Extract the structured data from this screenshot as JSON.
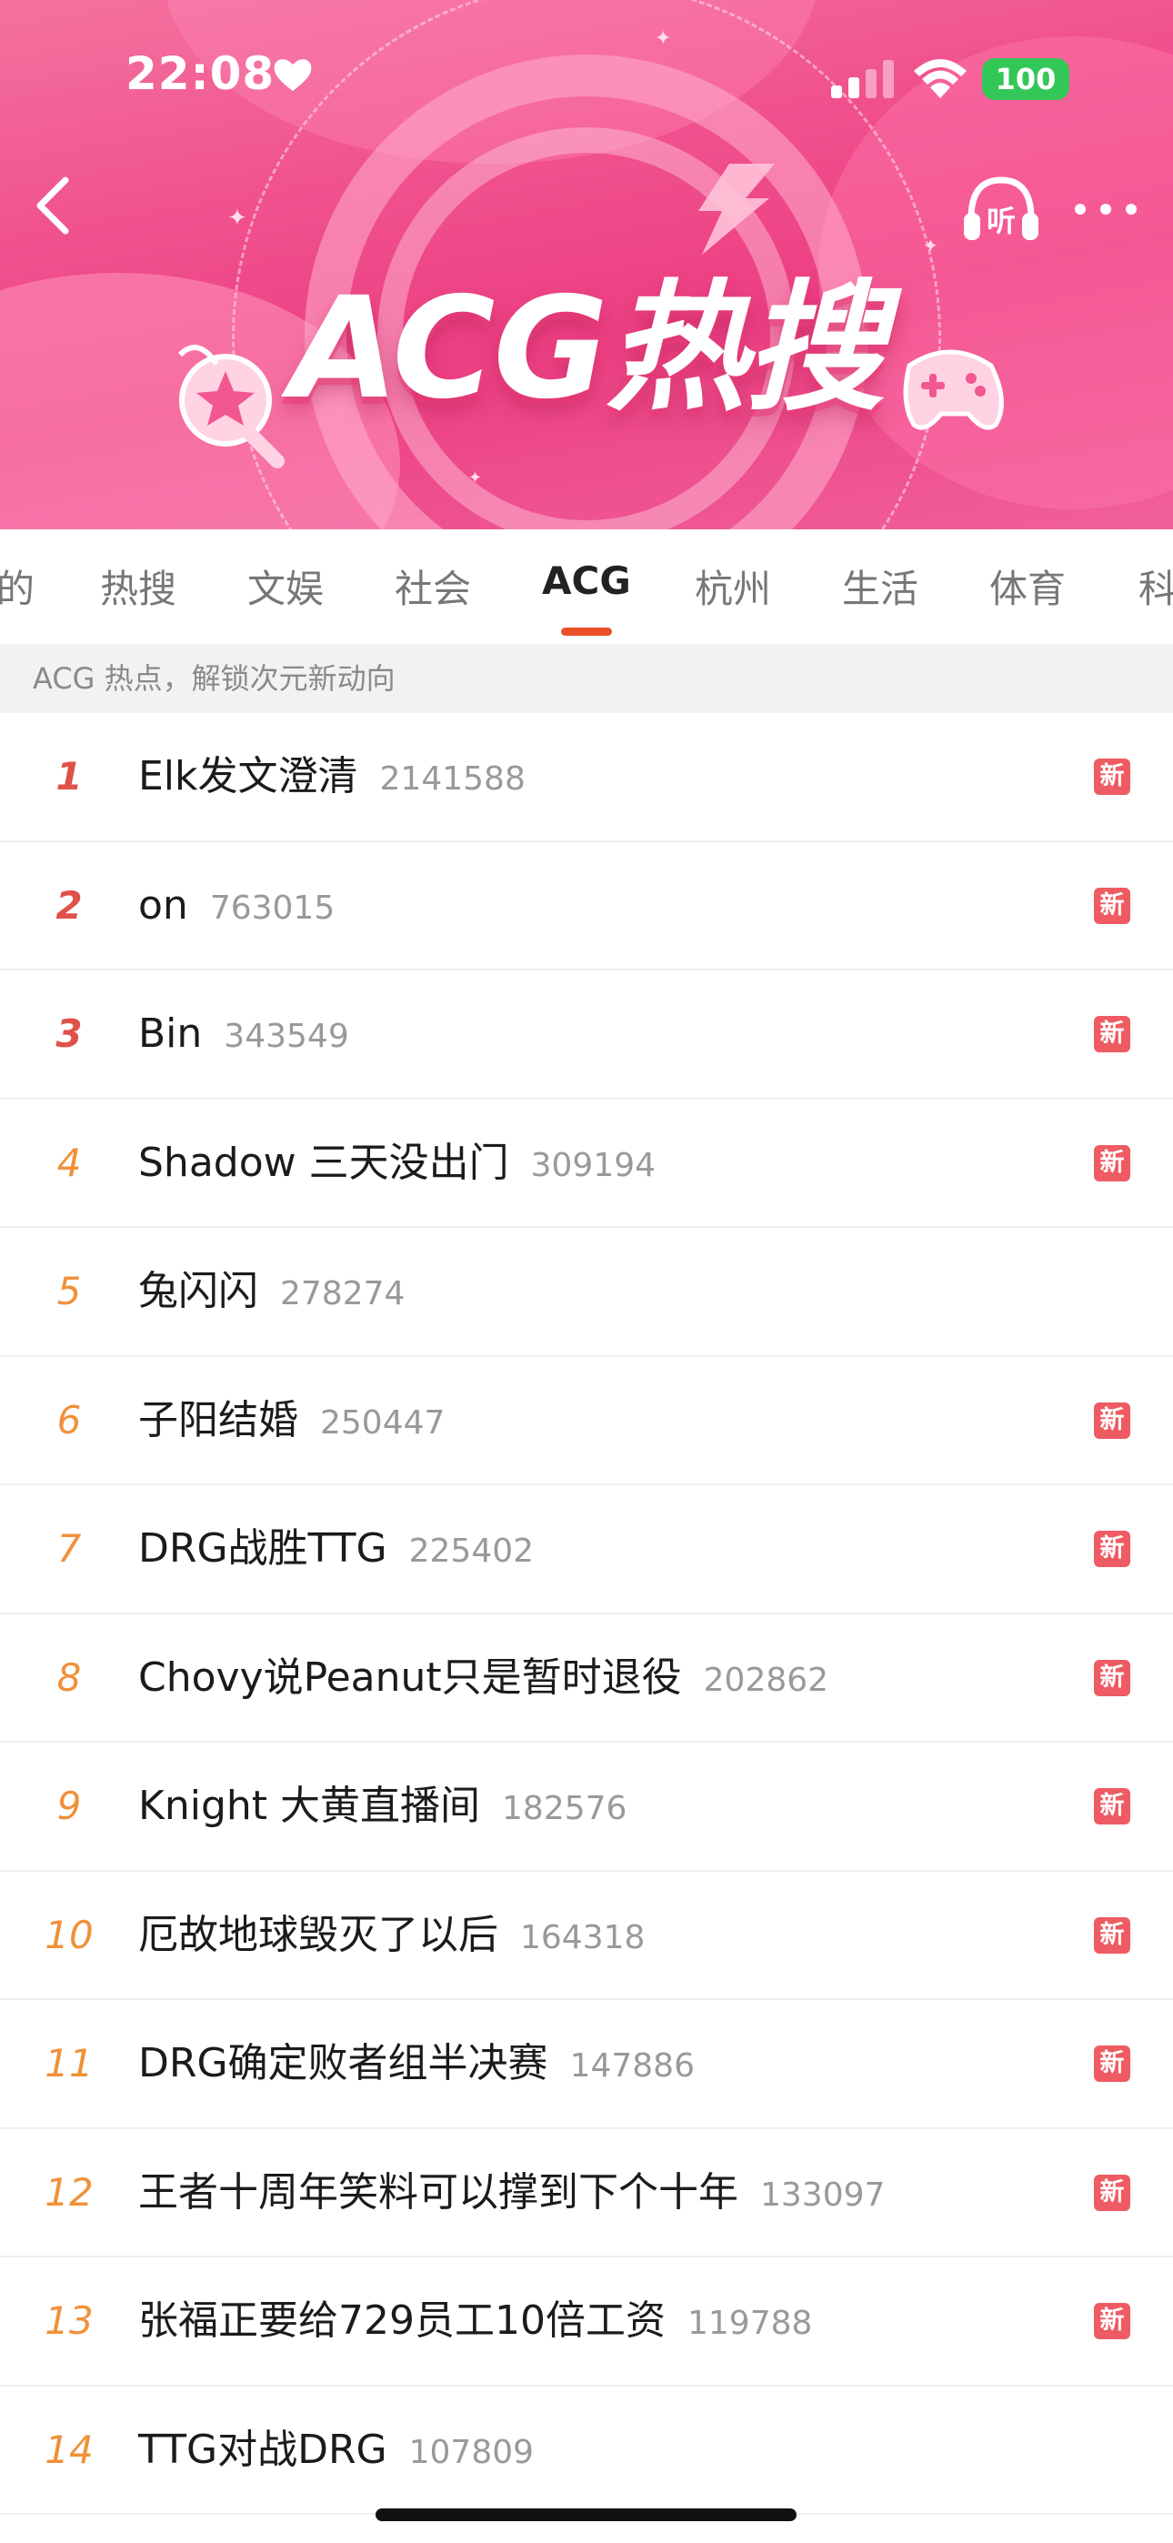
{
  "status_bar": {
    "time": "22:08",
    "battery": "100"
  },
  "header": {
    "title": "ACG热搜",
    "listen_label": "听"
  },
  "tabs": [
    {
      "label": "的"
    },
    {
      "label": "热搜"
    },
    {
      "label": "文娱"
    },
    {
      "label": "社会"
    },
    {
      "label": "ACG",
      "active": true
    },
    {
      "label": "杭州"
    },
    {
      "label": "生活"
    },
    {
      "label": "体育"
    },
    {
      "label": "科"
    }
  ],
  "subheader": "ACG 热点，解锁次元新动向",
  "badge_label": "新",
  "items": [
    {
      "rank": "1",
      "title": "Elk发文澄清",
      "count": "2141588",
      "new": true
    },
    {
      "rank": "2",
      "title": "on",
      "count": "763015",
      "new": true
    },
    {
      "rank": "3",
      "title": "Bin",
      "count": "343549",
      "new": true
    },
    {
      "rank": "4",
      "title": "Shadow 三天没出门",
      "count": "309194",
      "new": true
    },
    {
      "rank": "5",
      "title": "兔闪闪",
      "count": "278274",
      "new": false
    },
    {
      "rank": "6",
      "title": "子阳结婚",
      "count": "250447",
      "new": true
    },
    {
      "rank": "7",
      "title": "DRG战胜TTG",
      "count": "225402",
      "new": true
    },
    {
      "rank": "8",
      "title": "Chovy说Peanut只是暂时退役",
      "count": "202862",
      "new": true
    },
    {
      "rank": "9",
      "title": "Knight 大黄直播间",
      "count": "182576",
      "new": true
    },
    {
      "rank": "10",
      "title": "厄故地球毁灭了以后",
      "count": "164318",
      "new": true
    },
    {
      "rank": "11",
      "title": "DRG确定败者组半决赛",
      "count": "147886",
      "new": true
    },
    {
      "rank": "12",
      "title": "王者十周年笑料可以撑到下个十年",
      "count": "133097",
      "new": true
    },
    {
      "rank": "13",
      "title": "张福正要给729员工10倍工资",
      "count": "119788",
      "new": true
    },
    {
      "rank": "14",
      "title": "TTG对战DRG",
      "count": "107809",
      "new": false
    }
  ],
  "colors": {
    "accent": "#ea4f2a",
    "rank_top": "#e0514a",
    "rank_other": "#f0913a",
    "badge": "#ee5b63",
    "banner": "#ec3f82"
  },
  "icons": [
    "heart-icon",
    "signal-icon",
    "wifi-icon",
    "back-icon",
    "headphones-icon",
    "more-icon"
  ]
}
